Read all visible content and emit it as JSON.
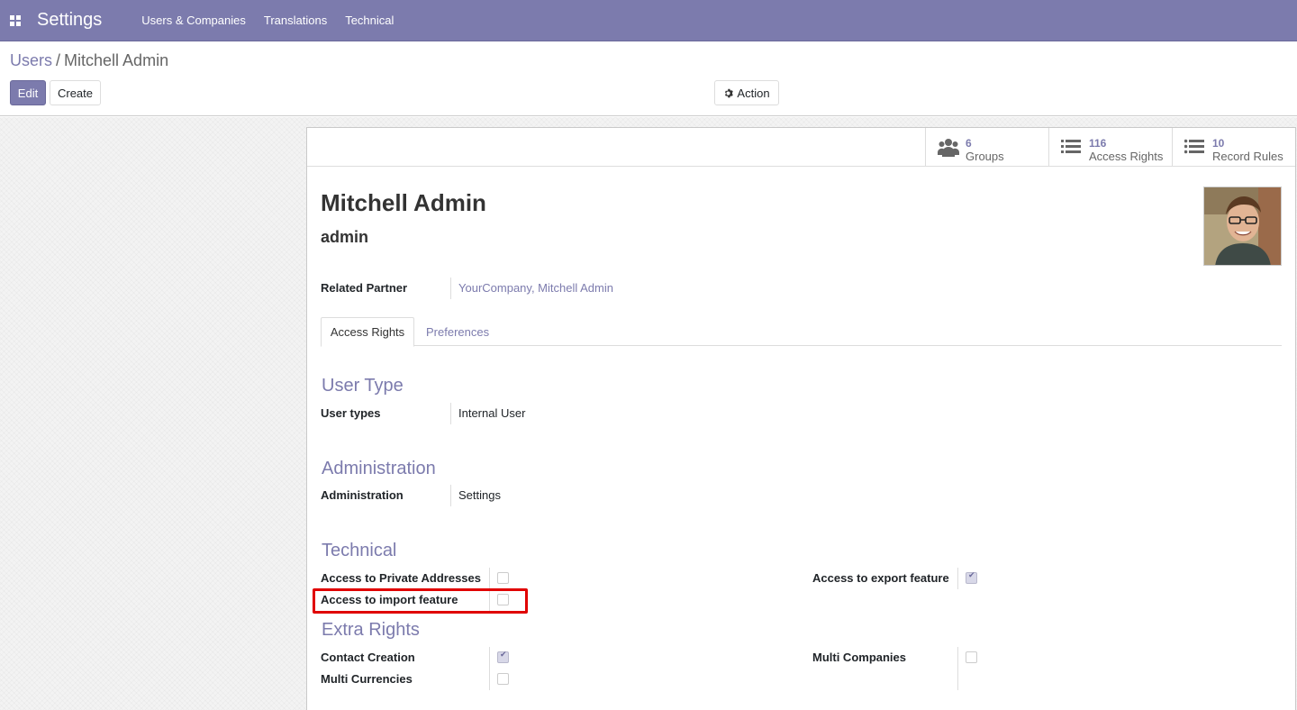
{
  "navbar": {
    "brand": "Settings",
    "menu": [
      "Users & Companies",
      "Translations",
      "Technical"
    ]
  },
  "breadcrumb": {
    "parent": "Users",
    "separator": "/",
    "current": "Mitchell Admin"
  },
  "buttons": {
    "edit": "Edit",
    "create": "Create",
    "action": "Action"
  },
  "stat_buttons": [
    {
      "value": "6",
      "label": "Groups",
      "icon": "users-icon"
    },
    {
      "value": "116",
      "label": "Access Rights",
      "icon": "list-icon"
    },
    {
      "value": "10",
      "label": "Record Rules",
      "icon": "list-icon"
    }
  ],
  "record": {
    "name": "Mitchell Admin",
    "login": "admin",
    "related_partner_label": "Related Partner",
    "related_partner_value": "YourCompany, Mitchell Admin"
  },
  "tabs": {
    "active": "Access Rights",
    "other": "Preferences"
  },
  "sections": {
    "user_type": {
      "title": "User Type",
      "label": "User types",
      "value": "Internal User"
    },
    "administration": {
      "title": "Administration",
      "label": "Administration",
      "value": "Settings"
    },
    "technical": {
      "title": "Technical",
      "private_addresses": {
        "label": "Access to Private Addresses",
        "checked": false
      },
      "import_feature": {
        "label": "Access to import feature",
        "checked": false
      },
      "export_feature": {
        "label": "Access to export feature",
        "checked": true
      }
    },
    "extra_rights": {
      "title": "Extra Rights",
      "contact_creation": {
        "label": "Contact Creation",
        "checked": true
      },
      "multi_currencies": {
        "label": "Multi Currencies",
        "checked": false
      },
      "multi_companies": {
        "label": "Multi Companies",
        "checked": false
      }
    }
  },
  "colors": {
    "brand": "#7c7bad",
    "highlight": "#e00000"
  }
}
